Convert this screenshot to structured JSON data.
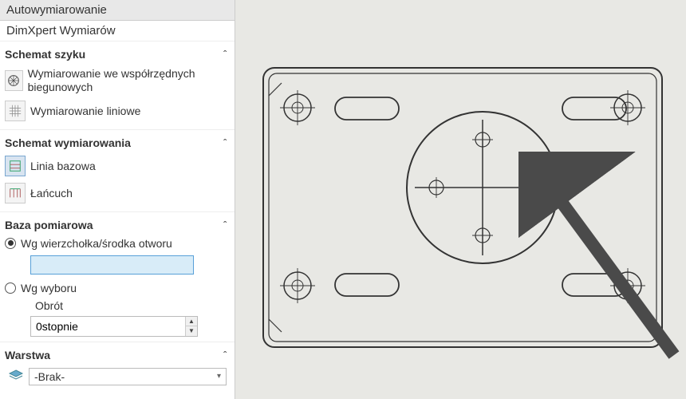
{
  "header": {
    "title": "Autowymiarowanie",
    "subtitle": "DimXpert Wymiarów"
  },
  "sections": {
    "patternScheme": {
      "title": "Schemat szyku",
      "polar": "Wymiarowanie we współrzędnych biegunowych",
      "linear": "Wymiarowanie liniowe"
    },
    "dimScheme": {
      "title": "Schemat wymiarowania",
      "baseline": "Linia bazowa",
      "chain": "Łańcuch"
    },
    "measureBase": {
      "title": "Baza pomiarowa",
      "byVertex": "Wg wierzchołka/środka otworu",
      "bySelection": "Wg wyboru",
      "rotationLabel": "Obrót",
      "rotationValue": "0stopnie"
    },
    "layer": {
      "title": "Warstwa",
      "value": "-Brak-"
    }
  },
  "chevron": "ˆ",
  "dropdownCaret": "▾"
}
